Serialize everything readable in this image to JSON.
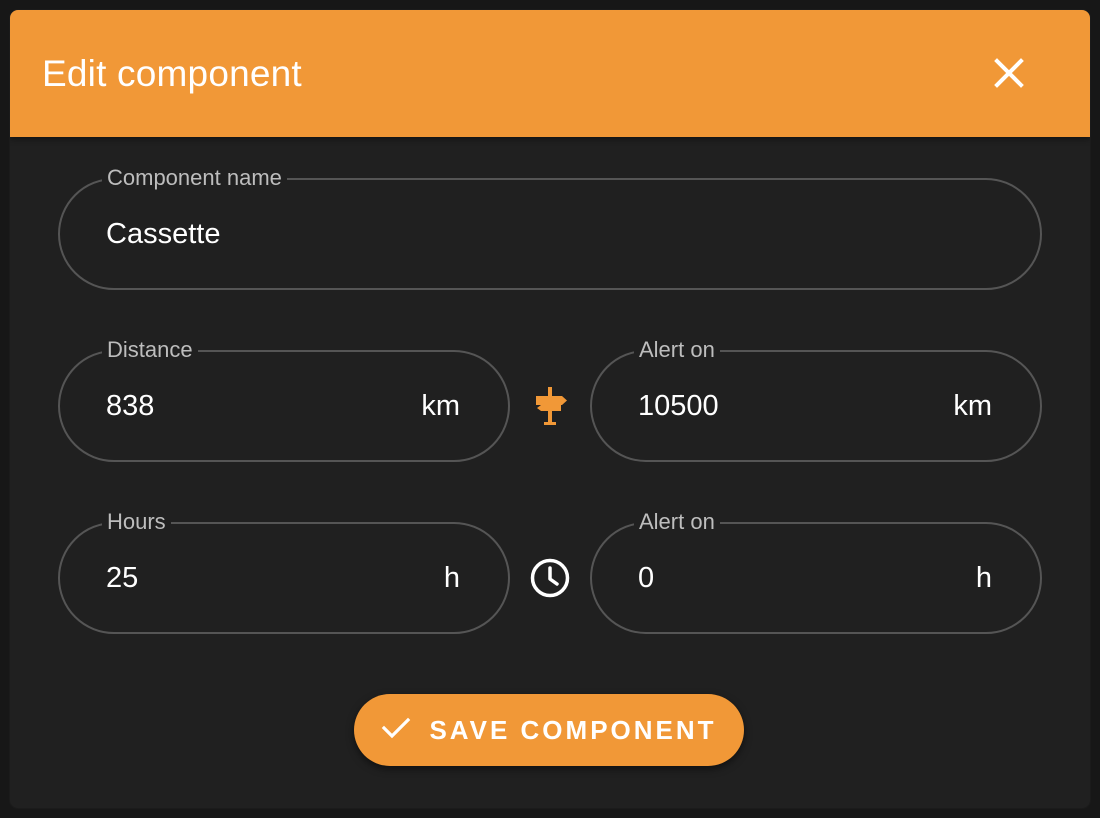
{
  "dialog": {
    "title": "Edit component",
    "close_icon": "close-icon",
    "accent_color": "#f19837"
  },
  "fields": {
    "component_name": {
      "label": "Component name",
      "value": "Cassette"
    },
    "distance": {
      "label": "Distance",
      "value": "838",
      "unit": "km"
    },
    "distance_alert": {
      "label": "Alert on",
      "value": "10500",
      "unit": "km"
    },
    "hours": {
      "label": "Hours",
      "value": "25",
      "unit": "h"
    },
    "hours_alert": {
      "label": "Alert on",
      "value": "0",
      "unit": "h"
    }
  },
  "icons": {
    "distance": "signpost-icon",
    "hours": "clock-icon",
    "save": "check-icon"
  },
  "actions": {
    "save_label": "SAVE COMPONENT"
  }
}
